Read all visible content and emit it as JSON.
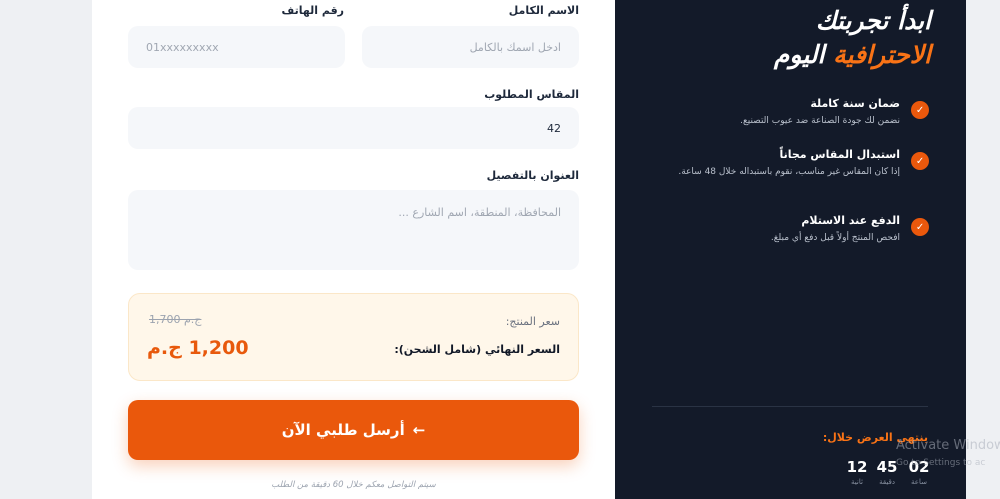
{
  "form": {
    "full_name": {
      "label": "الاسم الكامل",
      "placeholder": "ادخل اسمك بالكامل",
      "value": ""
    },
    "phone": {
      "label": "رقم الهاتف",
      "placeholder": "01xxxxxxxxx",
      "value": ""
    },
    "size": {
      "label": "المقاس المطلوب",
      "value": "42"
    },
    "address": {
      "label": "العنوان بالتفصيل",
      "placeholder": "المحافظة، المنطقة، اسم الشارع ...",
      "value": ""
    }
  },
  "pricing": {
    "product_price_label": "سعر المنتج:",
    "old_price": "1,700 ج.م",
    "final_price_label": "السعر النهائي (شامل الشحن):",
    "final_price": "1,200 ج.م"
  },
  "submit": {
    "label": "أرسل طلبي الآن",
    "arrow": "←"
  },
  "note": "سيتم التواصل معكم خلال 60 دقيقة من الطلب",
  "panel": {
    "headline_line1": "ابدأ تجربتك",
    "headline_line2_accent": "الاحترافية",
    "headline_line2_rest": "اليوم",
    "check_icon": "✓",
    "features": [
      {
        "title": "ضمان سنة كاملة",
        "desc": "نضمن لك جودة الصناعة ضد عيوب التصنيع."
      },
      {
        "title": "استبدال المقاس مجاناً",
        "desc": "إذا كان المقاس غير مناسب، نقوم باستبداله خلال 48 ساعة."
      },
      {
        "title": "الدفع عند الاستلام",
        "desc": "افحص المنتج أولاً قبل دفع أي مبلغ."
      }
    ],
    "offer_label": "ينتهي العرض خلال:",
    "countdown": [
      {
        "value": "02",
        "unit": "ساعة"
      },
      {
        "value": "45",
        "unit": "دقيقة"
      },
      {
        "value": "12",
        "unit": "ثانية"
      }
    ]
  },
  "watermark": {
    "line1": "Activate Window",
    "line2": "Go to Settings to ac"
  },
  "colors": {
    "accent": "#ea580c",
    "panel_bg": "#131a29",
    "price_bg": "#fff7ea"
  }
}
